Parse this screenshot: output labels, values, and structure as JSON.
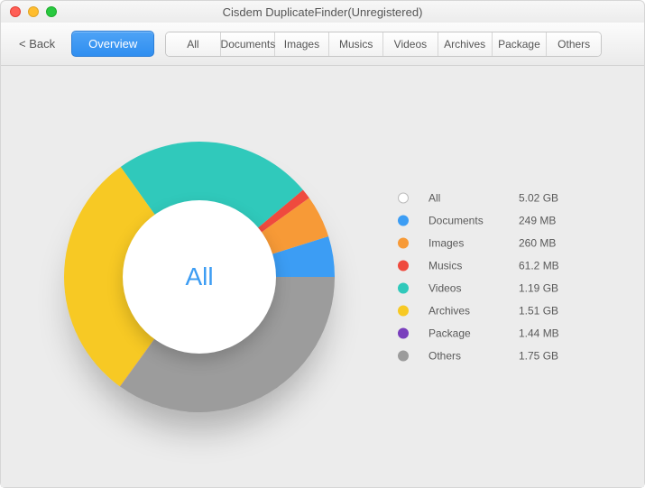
{
  "title": "Cisdem DuplicateFinder(Unregistered)",
  "toolbar": {
    "back_label": "< Back",
    "overview_label": "Overview",
    "tabs": [
      "All",
      "Documents",
      "Images",
      "Musics",
      "Videos",
      "Archives",
      "Package",
      "Others"
    ]
  },
  "chart_center": "All",
  "chart_data": {
    "type": "pie",
    "title": "",
    "series": [
      {
        "name": "Documents",
        "value_mb": 249,
        "display": "249 MB",
        "color": "#3c9df4"
      },
      {
        "name": "Images",
        "value_mb": 260,
        "display": "260 MB",
        "color": "#f79a37"
      },
      {
        "name": "Musics",
        "value_mb": 61.2,
        "display": "61.2 MB",
        "color": "#ef4a3e"
      },
      {
        "name": "Videos",
        "value_mb": 1218.56,
        "display": "1.19 GB",
        "color": "#30c9bb"
      },
      {
        "name": "Archives",
        "value_mb": 1546.24,
        "display": "1.51 GB",
        "color": "#f7c924"
      },
      {
        "name": "Package",
        "value_mb": 1.44,
        "display": "1.44 MB",
        "color": "#7a3fbd"
      },
      {
        "name": "Others",
        "value_mb": 1792,
        "display": "1.75 GB",
        "color": "#9c9c9c"
      }
    ],
    "total": {
      "name": "All",
      "display": "5.02 GB",
      "color": "#ffffff",
      "stroke": "#bcbcbc"
    }
  },
  "legend": [
    {
      "name": "All",
      "size": "5.02 GB",
      "color": "#ffffff",
      "stroke": "#bcbcbc"
    },
    {
      "name": "Documents",
      "size": "249 MB",
      "color": "#3c9df4"
    },
    {
      "name": "Images",
      "size": "260 MB",
      "color": "#f79a37"
    },
    {
      "name": "Musics",
      "size": "61.2 MB",
      "color": "#ef4a3e"
    },
    {
      "name": "Videos",
      "size": "1.19 GB",
      "color": "#30c9bb"
    },
    {
      "name": "Archives",
      "size": "1.51 GB",
      "color": "#f7c924"
    },
    {
      "name": "Package",
      "size": "1.44 MB",
      "color": "#7a3fbd"
    },
    {
      "name": "Others",
      "size": "1.75 GB",
      "color": "#9c9c9c"
    }
  ]
}
